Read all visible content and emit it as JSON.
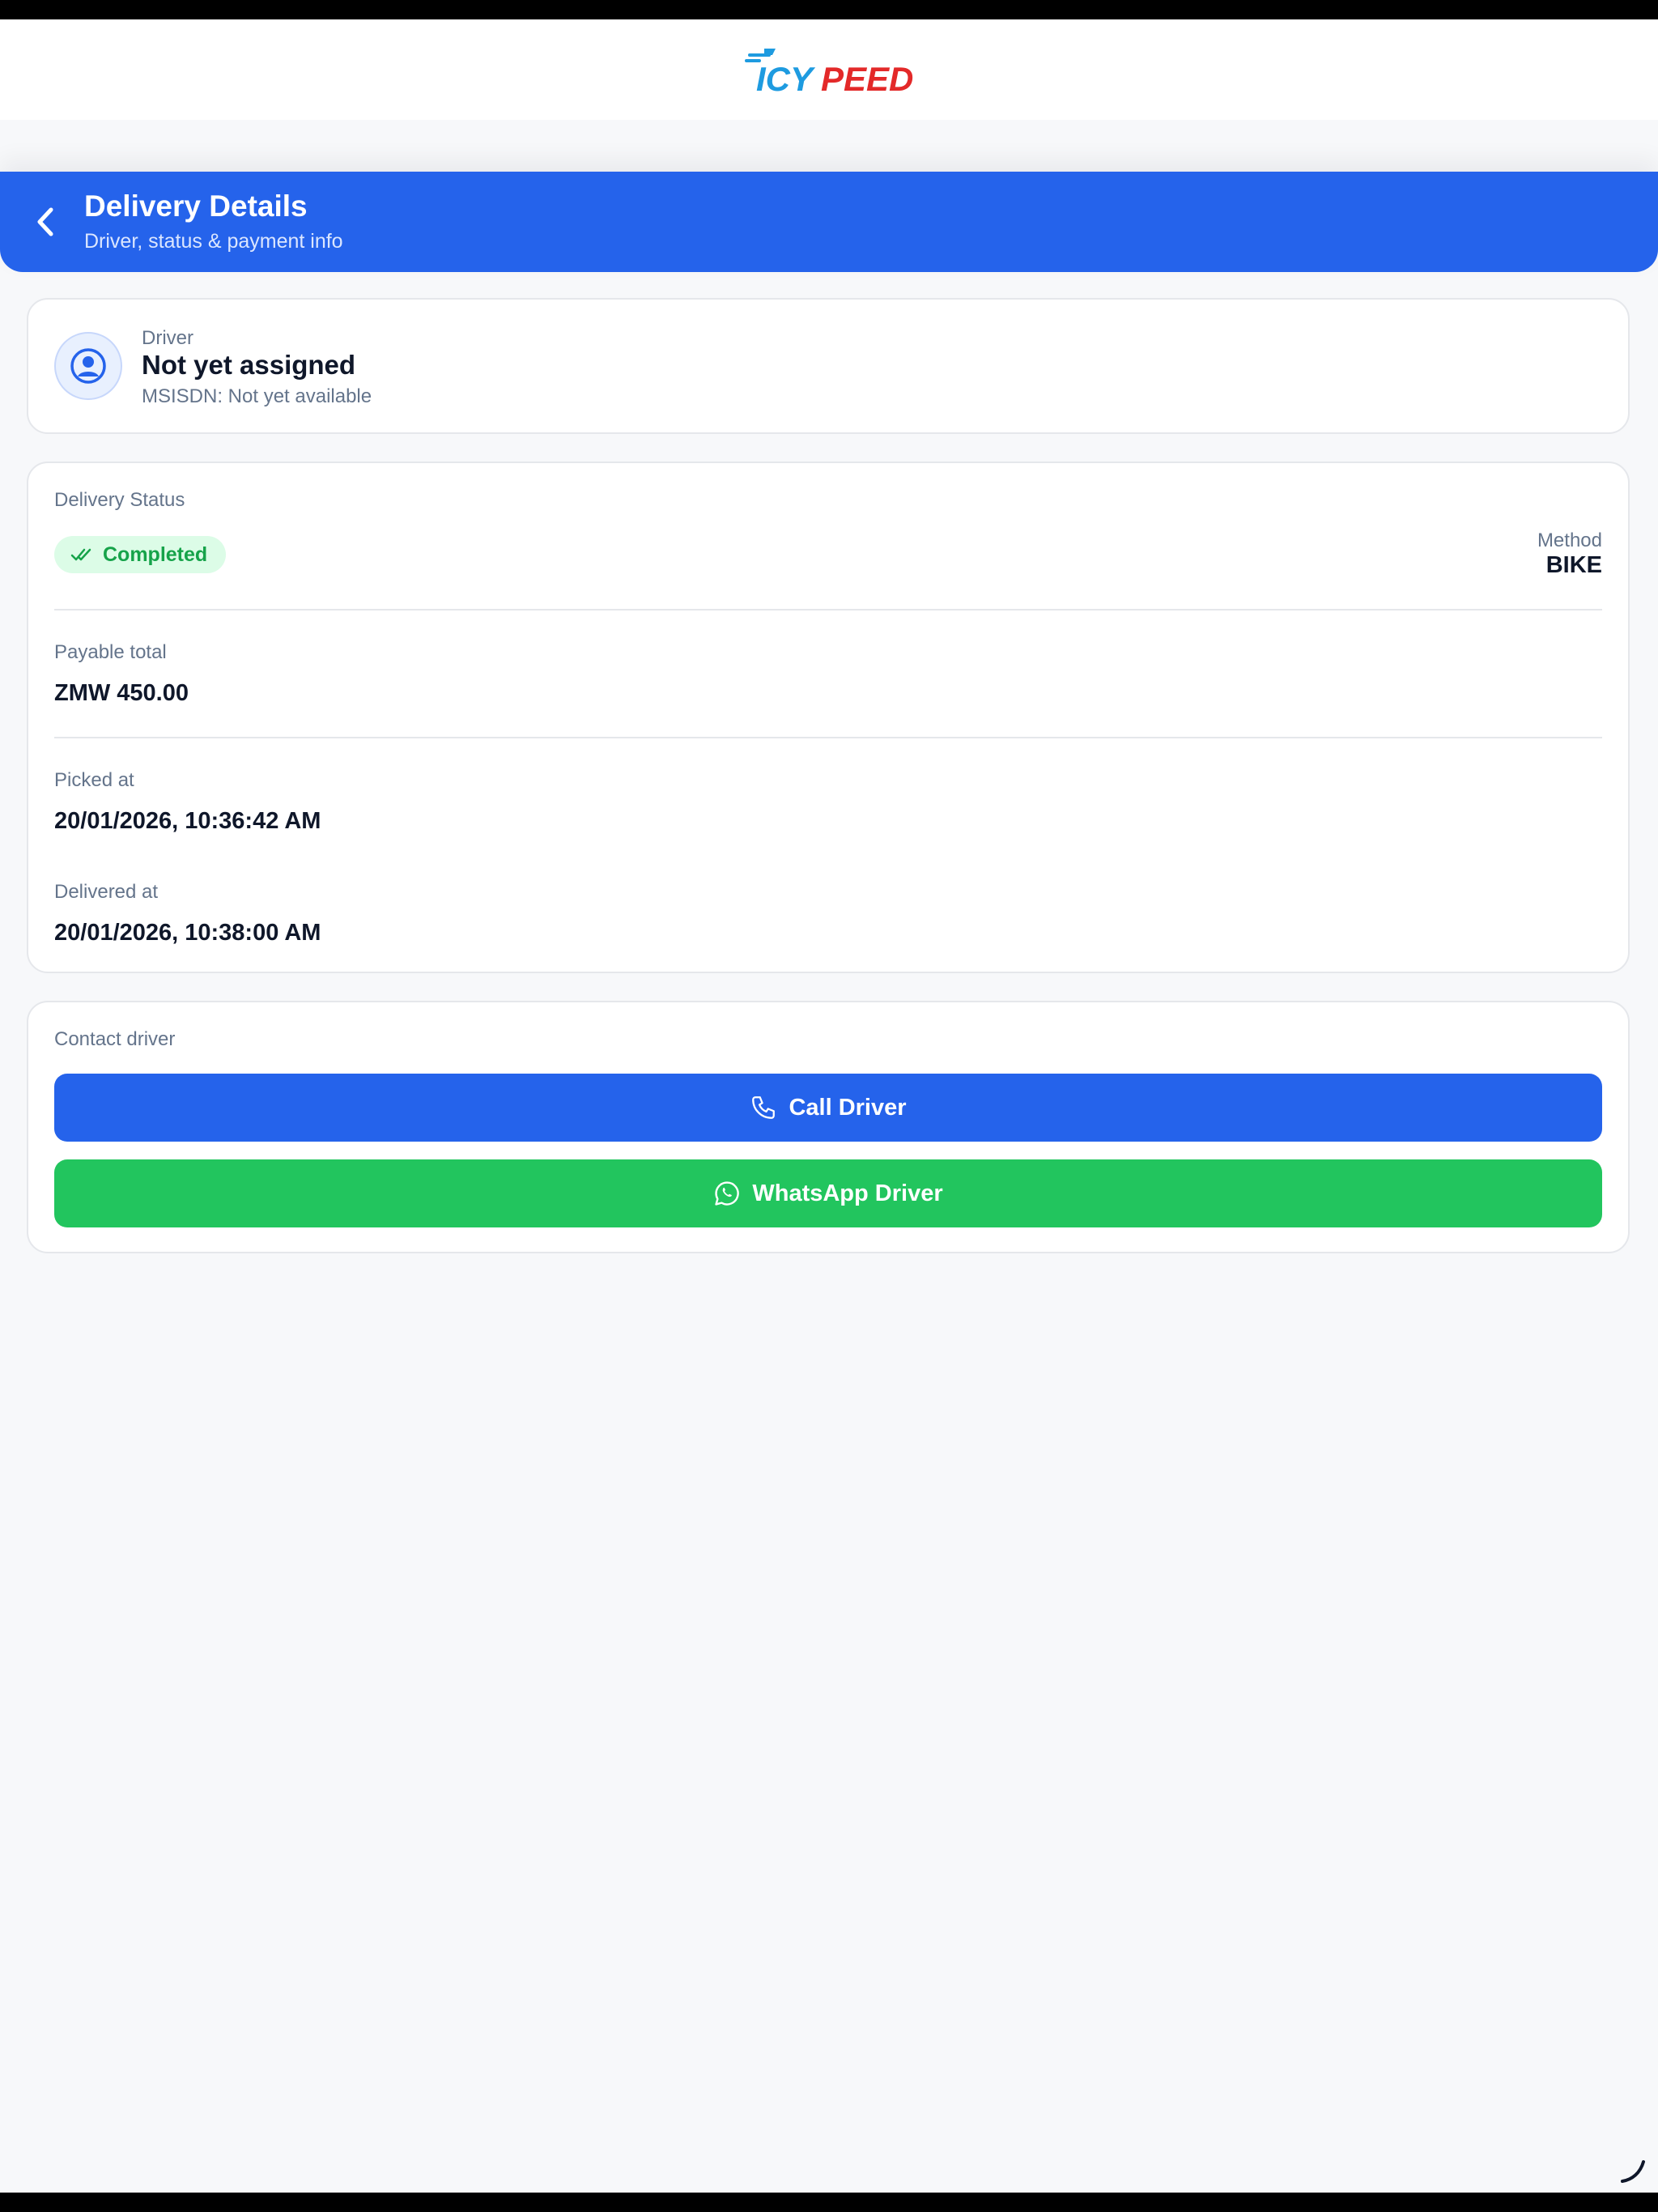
{
  "header": {
    "logo_text": "ICYPEED"
  },
  "hero": {
    "title": "Delivery Details",
    "subtitle": "Driver, status & payment info"
  },
  "driver": {
    "label": "Driver",
    "name": "Not yet assigned",
    "msisdn": "MSISDN: Not yet available"
  },
  "status": {
    "label": "Delivery Status",
    "badge": "Completed",
    "method_label": "Method",
    "method_value": "BIKE",
    "payable_label": "Payable total",
    "payable_value": "ZMW 450.00",
    "picked_label": "Picked at",
    "picked_value": "20/01/2026, 10:36:42 AM",
    "delivered_label": "Delivered at",
    "delivered_value": "20/01/2026, 10:38:00 AM"
  },
  "contact": {
    "label": "Contact driver",
    "call_label": "Call Driver",
    "whatsapp_label": "WhatsApp Driver"
  },
  "colors": {
    "primary": "#2563eb",
    "success": "#22c55e",
    "badge_bg": "#dcfce7",
    "badge_text": "#16a34a",
    "page_bg": "#f7f8fa"
  },
  "icons": [
    "chevron-left-icon",
    "user-circle-icon",
    "double-check-icon",
    "phone-icon",
    "whatsapp-icon"
  ]
}
